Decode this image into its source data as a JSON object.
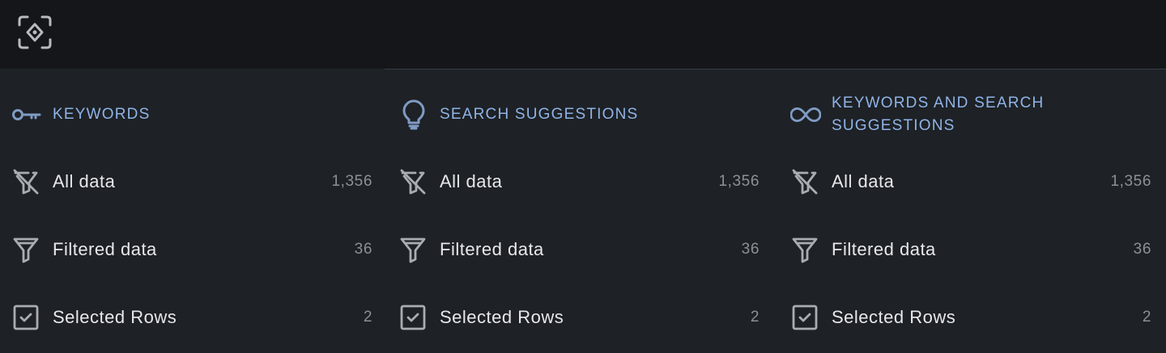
{
  "toolbar": {
    "focus_icon": "focus-target-icon"
  },
  "panels": [
    {
      "header": {
        "icon": "key-icon",
        "title": "KEYWORDS"
      },
      "rows": [
        {
          "icon": "filter-off-icon",
          "label": "All data",
          "count": "1,356"
        },
        {
          "icon": "funnel-icon",
          "label": "Filtered data",
          "count": "36"
        },
        {
          "icon": "checkbox-checked-icon",
          "label": "Selected Rows",
          "count": "2"
        }
      ]
    },
    {
      "header": {
        "icon": "lightbulb-icon",
        "title": "SEARCH SUGGESTIONS"
      },
      "rows": [
        {
          "icon": "filter-off-icon",
          "label": "All data",
          "count": "1,356"
        },
        {
          "icon": "funnel-icon",
          "label": "Filtered data",
          "count": "36"
        },
        {
          "icon": "checkbox-checked-icon",
          "label": "Selected Rows",
          "count": "2"
        }
      ]
    },
    {
      "header": {
        "icon": "infinity-icon",
        "title": "KEYWORDS AND SEARCH SUGGESTIONS"
      },
      "rows": [
        {
          "icon": "filter-off-icon",
          "label": "All data",
          "count": "1,356"
        },
        {
          "icon": "funnel-icon",
          "label": "Filtered data",
          "count": "36"
        },
        {
          "icon": "checkbox-checked-icon",
          "label": "Selected Rows",
          "count": "2"
        }
      ]
    }
  ],
  "colors": {
    "background": "#1e2125",
    "topbar": "#141619",
    "header_text": "#8fb4e8",
    "header_icon": "#7f9bc4",
    "row_text": "#e6e8eb",
    "count_text": "#8d9197",
    "row_icon": "#a9adb3"
  }
}
